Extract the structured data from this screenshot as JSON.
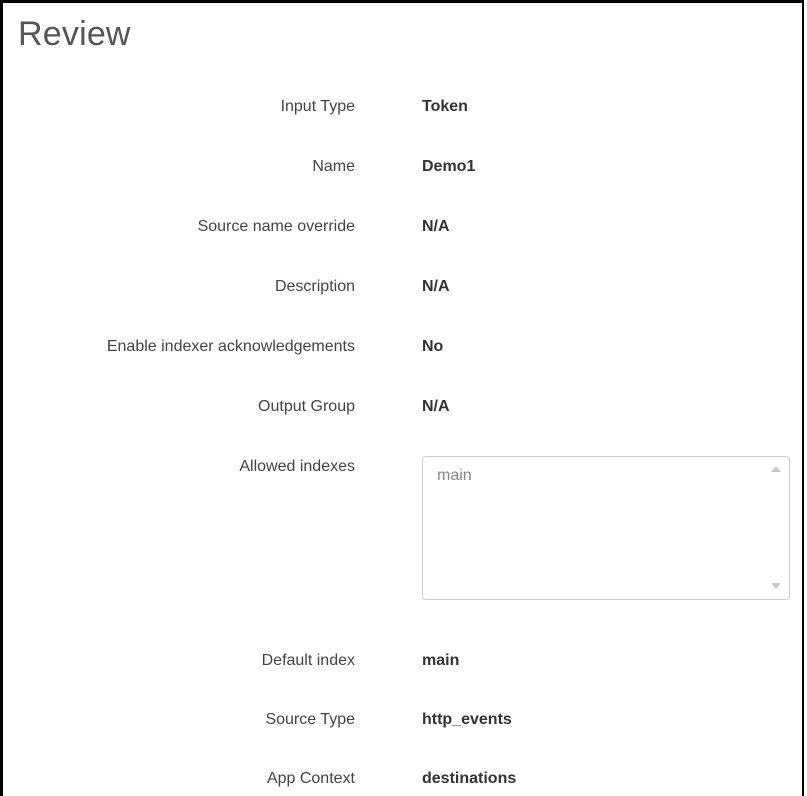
{
  "page": {
    "title": "Review"
  },
  "fields": [
    {
      "label": "Input Type",
      "value": "Token"
    },
    {
      "label": "Name",
      "value": "Demo1"
    },
    {
      "label": "Source name override",
      "value": "N/A"
    },
    {
      "label": "Description",
      "value": "N/A"
    },
    {
      "label": "Enable indexer acknowledgements",
      "value": "No"
    },
    {
      "label": "Output Group",
      "value": "N/A"
    }
  ],
  "allowed_indexes": {
    "label": "Allowed indexes",
    "value": "main"
  },
  "fields_after": [
    {
      "label": "Default index",
      "value": "main"
    },
    {
      "label": "Source Type",
      "value": "http_events"
    },
    {
      "label": "App Context",
      "value": "destinations"
    }
  ],
  "icons": {
    "scroll_up": "chevron-up-icon",
    "scroll_down": "chevron-down-icon"
  }
}
